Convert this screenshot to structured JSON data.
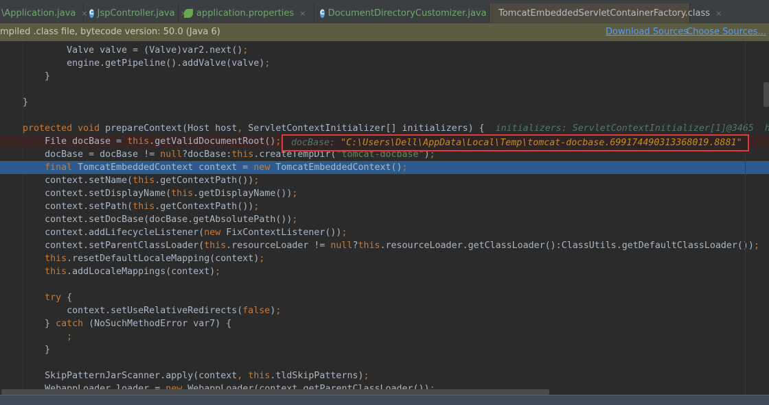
{
  "tabs": [
    {
      "label": "\\Application.java",
      "icon": "class-icon",
      "active": false
    },
    {
      "label": "JspController.java",
      "icon": "class-icon",
      "active": false
    },
    {
      "label": "application.properties",
      "icon": "spring-properties-icon",
      "active": false
    },
    {
      "label": "DocumentDirectoryCustomizer.java",
      "icon": "class-icon",
      "active": false
    },
    {
      "label": "TomcatEmbeddedServletContainerFactory.class",
      "icon": "compiled-class-icon",
      "active": true
    }
  ],
  "tab_close_glyph": "×",
  "tab_icon_letter": "C",
  "notice": {
    "message": "mpiled .class file, bytecode version: 50.0 (Java 6)",
    "download_sources": "Download Sources",
    "choose_sources": "Choose Sources..."
  },
  "keywords": [
    "protected",
    "void",
    "this",
    "new",
    "null",
    "final",
    "try",
    "catch",
    "false"
  ],
  "code_lines": [
    "        Valve valve = (Valve)var2.next();",
    "        engine.getPipeline().addValve(valve);",
    "    }",
    "",
    "}",
    "",
    "protected void prepareContext(Host host, ServletContextInitializer[] initializers) {",
    "    File docBase = this.getValidDocumentRoot();",
    "    docBase = docBase != null?docBase:this.createTempDir(\"tomcat-docbase\");",
    "    final TomcatEmbeddedContext context = new TomcatEmbeddedContext();",
    "    context.setName(this.getContextPath());",
    "    context.setDisplayName(this.getDisplayName());",
    "    context.setPath(this.getContextPath());",
    "    context.setDocBase(docBase.getAbsolutePath());",
    "    context.addLifecycleListener(new FixContextListener());",
    "    context.setParentClassLoader(this.resourceLoader != null?this.resourceLoader.getClassLoader():ClassUtils.getDefaultClassLoader());",
    "    this.resetDefaultLocaleMapping(context);",
    "    this.addLocaleMappings(context);",
    "",
    "    try {",
    "        context.setUseRelativeRedirects(false);",
    "    } catch (NoSuchMethodError var7) {",
    "        ;",
    "    }",
    "",
    "    SkipPatternJarScanner.apply(context, this.tldSkipPatterns);",
    "    WebappLoader loader = new WebappLoader(context.getParentClassLoader());"
  ],
  "breakpoint_line": 7,
  "selected_line": 9,
  "inline_hint": "initializers: ServletContextInitializer[1]@3465  h",
  "debug_value": {
    "label": "docBase: ",
    "value": "\"C:\\Users\\Dell\\AppData\\Local\\Temp\\tomcat-docbase.6991744903133680​19.8881\""
  },
  "colors": {
    "keyword": "#cc7832",
    "string": "#6a8759",
    "selection": "#2d5b8e",
    "highlight_box": "#e03c3c"
  }
}
